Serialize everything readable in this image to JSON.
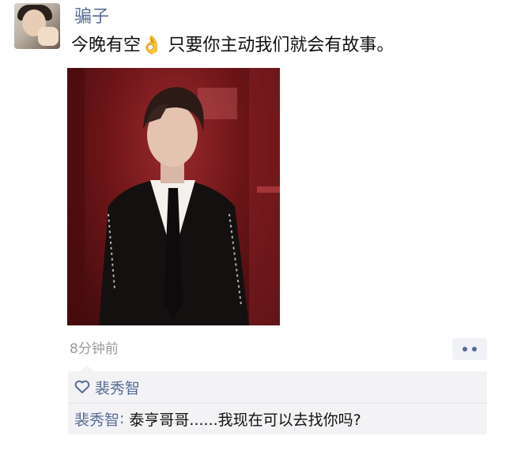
{
  "post": {
    "username": "骗子",
    "text": "今晚有空👌 只要你主动我们就会有故事。",
    "timestamp": "8分钟前"
  },
  "likes": {
    "names": "裴秀智"
  },
  "comments": [
    {
      "author": "裴秀智",
      "separator": ":",
      "text": "泰亨哥哥......我现在可以去找你吗?"
    }
  ],
  "icons": {
    "like": "heart-outline-icon",
    "more": "more-dots-icon"
  },
  "colors": {
    "name_link": "#576b95",
    "timestamp": "#9b9b9b",
    "comment_bg": "#f3f3f5"
  }
}
